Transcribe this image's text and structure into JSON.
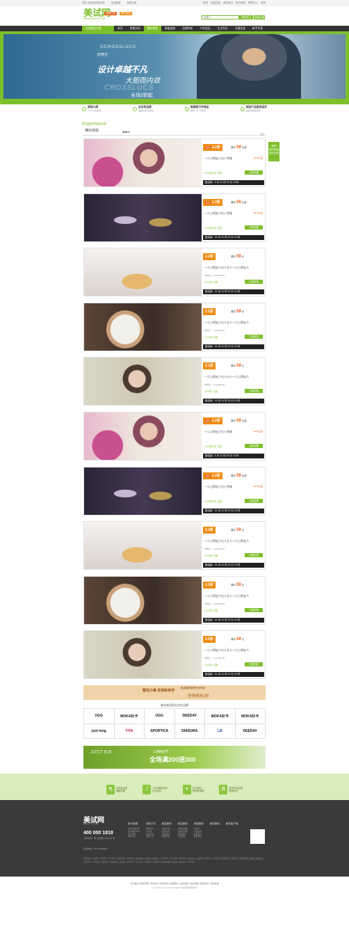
{
  "topbar": {
    "left": [
      "您好,欢迎来到美试网",
      "欢迎登录",
      "免费注册"
    ],
    "right": [
      "登录",
      "免费注册",
      "我的美试",
      "积分商城",
      "帮助中心",
      "官网"
    ]
  },
  "header": {
    "logo": "美试网",
    "logo_sub": "WWW.MAXTP.COM",
    "tag1": "轻奢试用",
    "tag2": "美试活动",
    "search_placeholder": "请输入",
    "search_button": "搜索宝贝",
    "search_button2": "搜索店铺"
  },
  "nav": {
    "category": "全部商品分类",
    "items": [
      "首页",
      "免费试用",
      "裸价体验",
      "限量抢购",
      "品牌特卖",
      "户外用品",
      "生活专区",
      "天猫优选",
      "新手专享"
    ]
  },
  "banner": {
    "brand_en": "OCROSSLUCS",
    "brand_cn": "欧奢丝",
    "headline": "设计卓越不凡",
    "subheadline": "大胆而内敛",
    "watermark": "CROSSLUCS",
    "offer": "全场2折起"
  },
  "features": [
    {
      "title": "原装大牌",
      "sub": "100%正品保证"
    },
    {
      "title": "全场免运费",
      "sub": "满额立减 免运费"
    },
    {
      "title": "每周数万件商品",
      "sub": "更新一次 不错过"
    },
    {
      "title": "体验产品提供返折",
      "sub": "返利到账更快捷"
    }
  ],
  "section": {
    "title_en": "Experience",
    "title_cn": "裸价体验",
    "brand": "ONLY",
    "more": "更多>"
  },
  "side_button": "我的\n裸价体验\n返回顶部",
  "products": [
    {
      "image": "girl-flowers",
      "badge": "疯抢",
      "discount": "2.2折",
      "price_label": "裸价",
      "price": "59",
      "unit": "元起",
      "name": "一二三四五六七八专场",
      "tag": "100%正品",
      "orig": "",
      "sold": "1234567件 已售",
      "buy": "立即查看",
      "timer": "距结束：0 天 21 时 22 分 12 秒"
    },
    {
      "image": "perfume",
      "badge": "疯抢",
      "discount": "2.2折",
      "price_label": "裸价",
      "price": "59",
      "unit": "元起",
      "name": "一二三四五六七八专场",
      "tag": "100%正品",
      "orig": "",
      "sold": "1234567件 已售",
      "buy": "立即查看",
      "timer": "距结束：01 天 21 时 22 分 12 秒"
    },
    {
      "image": "bottle",
      "badge": "",
      "discount": "2.2折",
      "price_label": "裸价",
      "price": "59",
      "unit": "元",
      "name": "一二三四五六七八九十一二三四五六",
      "tag": "",
      "orig": "市场价：￥123456.00",
      "sold": "1234件 已售",
      "buy": "立即抢购",
      "timer": "距结束：01 天 21 时 22 分 12 秒"
    },
    {
      "image": "watch",
      "badge": "",
      "discount": "2.2折",
      "price_label": "裸价",
      "price": "59",
      "unit": "元",
      "name": "一二三四五六七八九十一二三四五六",
      "tag": "",
      "orig": "市场价：￥123456.00",
      "sold": "1234件 已售",
      "buy": "立即抢购",
      "timer": "距结束：01 天 21 时 22 分 12 秒"
    },
    {
      "image": "camera-girl",
      "badge": "",
      "discount": "2.2折",
      "price_label": "裸价",
      "price": "59",
      "unit": "元",
      "name": "一二三四五六七八九十一二三四五六",
      "tag": "",
      "orig": "市场价：￥123456.00",
      "sold": "1234件 已售",
      "buy": "立即抢购",
      "timer": "距结束：01 天 21 时 22 分 12 秒"
    },
    {
      "image": "girl-flowers",
      "badge": "疯抢",
      "discount": "2.2折",
      "price_label": "裸价",
      "price": "59",
      "unit": "元起",
      "name": "一二三四五六七八专场",
      "tag": "100%正品",
      "orig": "",
      "sold": "1234567件 已售",
      "buy": "立即查看",
      "timer": "距结束：0 天 21 时 22 分 12 秒"
    },
    {
      "image": "perfume",
      "badge": "疯抢",
      "discount": "2.2折",
      "price_label": "裸价",
      "price": "59",
      "unit": "元起",
      "name": "一二三四五六七八专场",
      "tag": "100%正品",
      "orig": "",
      "sold": "1234567件 已售",
      "buy": "立即查看",
      "timer": "距结束：01 天 21 时 22 分 12 秒"
    },
    {
      "image": "bottle",
      "badge": "",
      "discount": "2.2折",
      "price_label": "裸价",
      "price": "59",
      "unit": "元",
      "name": "一二三四五六七八九十一二三四五六",
      "tag": "",
      "orig": "市场价：￥123456.00",
      "sold": "1234件 已售",
      "buy": "立即抢购",
      "timer": "距结束：01 天 21 时 22 分 12 秒"
    },
    {
      "image": "watch",
      "badge": "",
      "discount": "2.2折",
      "price_label": "裸价",
      "price": "59",
      "unit": "元",
      "name": "一二三四五六七八九十一二三四五六",
      "tag": "",
      "orig": "市场价：￥123456.00",
      "sold": "1234件 已售",
      "buy": "立即抢购",
      "timer": "距结束：01 天 21 时 22 分 12 秒"
    },
    {
      "image": "camera-girl",
      "badge": "",
      "discount": "2.2折",
      "price_label": "裸价",
      "price": "59",
      "unit": "元",
      "name": "一二三四五六七八九十一二三四五六",
      "tag": "",
      "orig": "市场价：￥123456.00",
      "sold": "1234件 已售",
      "buy": "立即抢购",
      "timer": "距结束：01 天 21 时 22 分 12 秒"
    }
  ],
  "promo": {
    "a": "繁花の春 发现新饰界",
    "b": "甄选最新春季时尚饰品",
    "c": "全场低至1折"
  },
  "brands": {
    "title": "美试来回现名合作品牌",
    "items": [
      "UGG",
      "MOKA衫卡",
      "UGG",
      "DEEDAY",
      "MOKA衫卡",
      "MOKA衫卡",
      "just long",
      "YIYA",
      "SPORTICA",
      "DIADORA",
      "LB",
      "DEEDAY"
    ]
  },
  "green_banner": {
    "t1": "JUST B.B",
    "t2": "三月桃花节",
    "t3": "全场满200送300"
  },
  "guarantees": [
    {
      "icon": "免",
      "title": "全场免运费",
      "sub": "满额包邮"
    },
    {
      "icon": "7",
      "title": "7天无理由退货",
      "sub": "售后无忧"
    },
    {
      "icon": "¥",
      "title": "先行赔付",
      "sub": "购物有保障"
    },
    {
      "icon": "券",
      "title": "退货补贴运费",
      "sub": "购物无忧"
    }
  ],
  "footer": {
    "logo": "美试网",
    "logo_sub": "MAXTP.COM",
    "phone": "400 000 1818",
    "hours": "工作时间：周一至周日 9:00-19:00",
    "qq": "投诉电话：010-66666666",
    "columns": [
      {
        "title": "新手指南",
        "links": [
          "新手试用指南",
          "新手裸价体验",
          "积分规则",
          "帮助中心"
        ]
      },
      {
        "title": "付款方式",
        "links": [
          "网银支付",
          "支付宝",
          "货到付款",
          "邮局汇款"
        ]
      },
      {
        "title": "配送服务",
        "links": [
          "配送方式",
          "配送时间",
          "配送费用",
          "验货签收"
        ]
      },
      {
        "title": "售后服务",
        "links": [
          "退换货政策",
          "退换货流程",
          "退款说明",
          "三包服务"
        ]
      },
      {
        "title": "特色服务",
        "links": [
          "礼品卡",
          "礼品包装",
          "会员积分",
          "会员特权"
        ]
      },
      {
        "title": "美试微信",
        "links": []
      },
      {
        "title": "美试客户端",
        "links": []
      }
    ],
    "links": "品牌站点 | 美试网 | 合作伙伴 | 关于我们 | 联系我们 | 招聘英才 | 网站地图 | 美试网 | 品牌站点 | 合作伙伴 | 关于我们 | 联系我们 | 品牌站点 | 美试网 | 合作伙伴 | 关于我们 | 联系我们 | 招聘英才 | 网站地图 | 美试网 | 品牌站点 | 合作伙伴 | 关于我们 | 联系我们 | 品牌站点 | 美试网 | 合作伙伴 | 关于我们 | 联系我们 | 招聘英才 | 网站地图 | 美试网 | 品牌站点 | 合作伙伴"
  },
  "copyright": {
    "line1": "关于美试 | 网站声明 | 商务合作 | 联系我们 | 招聘英才 | 友情链接 | 站点地图 | 服务协议 | 隐私政策",
    "line2": "© All rights Reserved by MaXTP 美试网 版权所有"
  },
  "colors": {
    "accent": "#7dbf2a",
    "orange": "#f08c14",
    "dark": "#333333"
  }
}
